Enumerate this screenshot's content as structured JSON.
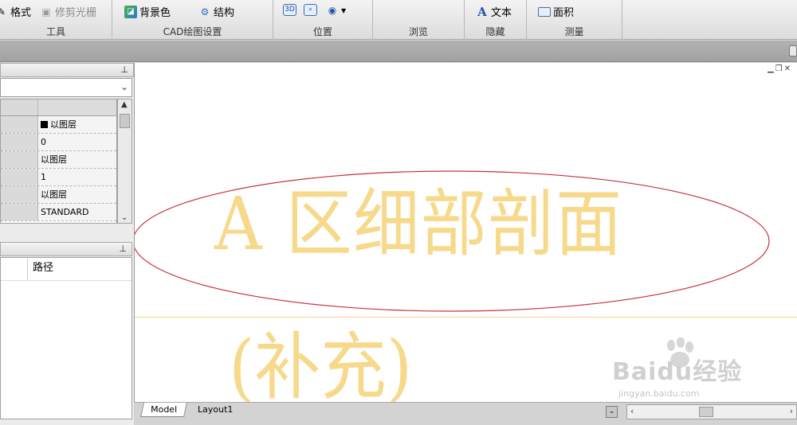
{
  "ribbon": {
    "groups": [
      {
        "label": "工具",
        "buttons": [
          {
            "label": "格式",
            "icon": "format-painter-icon",
            "disabled": false
          },
          {
            "label": "修剪光栅",
            "icon": "raster-clip-icon",
            "disabled": true
          }
        ]
      },
      {
        "label": "CAD绘图设置",
        "buttons": [
          {
            "label": "背景色",
            "icon": "background-color-icon"
          },
          {
            "label": "结构",
            "icon": "structure-icon"
          }
        ]
      },
      {
        "label": "位置",
        "buttons": [
          {
            "icon": "3d-view-icon"
          },
          {
            "icon": "zoom-icon"
          },
          {
            "icon": "orbit-dropdown-icon"
          }
        ]
      },
      {
        "label": "浏览",
        "buttons": []
      },
      {
        "label": "隐藏",
        "buttons": [
          {
            "label": "文本",
            "icon": "text-A-icon"
          }
        ]
      },
      {
        "label": "测量",
        "buttons": [
          {
            "label": "面积",
            "icon": "area-measure-icon"
          }
        ]
      }
    ]
  },
  "properties": {
    "rows": [
      {
        "value": "以图层",
        "swatch": "#000000"
      },
      {
        "value": "0"
      },
      {
        "value": "以图层"
      },
      {
        "value": "1"
      },
      {
        "value": "以图层"
      },
      {
        "value": "STANDARD"
      }
    ]
  },
  "files_panel": {
    "column_header": "路径"
  },
  "drawing": {
    "title_text": "A 区细部剖面",
    "subtitle_text": "(补充)",
    "text_color": "#f7d98b",
    "ellipse_color": "#c8323a"
  },
  "tabs": [
    {
      "label": "Model",
      "active": true
    },
    {
      "label": "Layout1",
      "active": false
    }
  ],
  "watermark": {
    "main": "Baidu经验",
    "sub": "jingyan.baidu.com"
  }
}
